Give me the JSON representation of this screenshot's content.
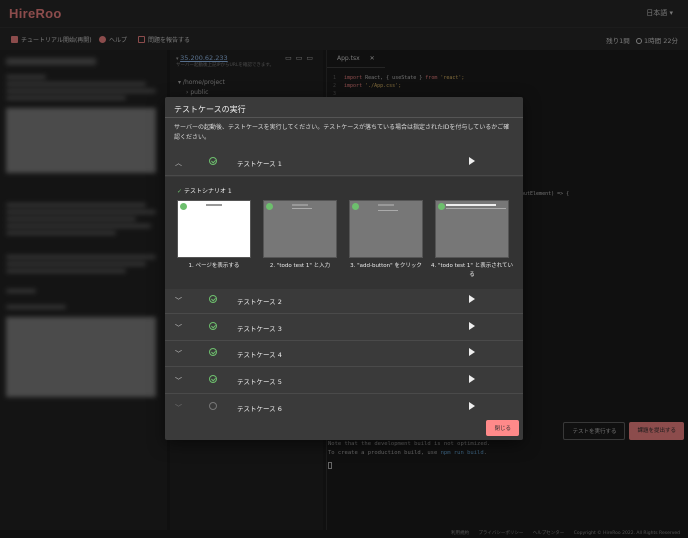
{
  "app": {
    "logo": "HireRoo",
    "language": "日本語 ▾"
  },
  "toolbar": {
    "tutorial": "チュートリアル開始(再開)",
    "help": "ヘルプ",
    "submit_question": "問題を報告する",
    "remaining": "残り1問",
    "time": "1時間 22分"
  },
  "file_pane": {
    "ip": "35.200.62.233",
    "ip_note": "サーバー起動後上記IPからURLを確認できます。",
    "root": "/home/project",
    "folder": "public"
  },
  "editor": {
    "tab": "App.tsx",
    "line_numbers": [
      "1",
      "2",
      "3"
    ],
    "code_line1_a": "import",
    "code_line1_b": " React, { useState } ",
    "code_line1_c": "from",
    "code_line1_d": " 'react';",
    "code_line2_a": "import",
    "code_line2_b": " './App.css';",
    "code_fragment": "putElement) => {",
    "run_tests": "テストを実行する",
    "submit": "課題を提出する"
  },
  "terminal": {
    "line1": "Note that the development build is not optimized.",
    "line2_a": "To create a production build, use ",
    "line2_b": "npm run build",
    "line2_c": "."
  },
  "footer": {
    "terms": "利用規約",
    "privacy": "プライバシーポリシー",
    "help_center": "ヘルプセンター",
    "copyright": "Copyright © HireRoo 2022. All Rights Reserved"
  },
  "modal": {
    "title": "テストケースの実行",
    "description": "サーバーの起動後、テストケースを実行してください。テストケースが落ちている場合は指定されたIDを付与しているかご確認ください。",
    "scenario_title": "テストシナリオ 1",
    "steps": [
      "1. ページを表示する",
      "2. \"todo test 1\" と入力",
      "3. \"add-button\" をクリック",
      "4. \"todo test 1\" と表示されている"
    ],
    "cases": [
      {
        "label": "テストケース 1",
        "passed": true
      },
      {
        "label": "テストケース 2",
        "passed": true
      },
      {
        "label": "テストケース 3",
        "passed": true
      },
      {
        "label": "テストケース 4",
        "passed": true
      },
      {
        "label": "テストケース 5",
        "passed": true
      },
      {
        "label": "テストケース 6",
        "passed": false
      }
    ],
    "close": "閉じる"
  },
  "colors": {
    "accent": "#ff8a8a",
    "success": "#6dbf6d",
    "link": "#9ecbff"
  }
}
